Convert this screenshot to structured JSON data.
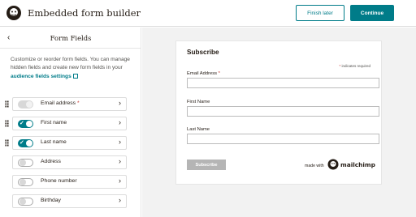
{
  "header": {
    "title": "Embedded form builder",
    "finish_later_label": "Finish later",
    "continue_label": "Continue"
  },
  "panel": {
    "back_glyph": "‹",
    "title": "Form Fields",
    "help_text": "Customize or reorder form fields. You can manage hidden fields and create new form fields in your ",
    "help_link": "audience fields settings",
    "fields": [
      {
        "label": "Email address",
        "required_mark": "*",
        "state": "disabled"
      },
      {
        "label": "First name",
        "state": "on"
      },
      {
        "label": "Last name",
        "state": "on"
      },
      {
        "label": "Address",
        "state": "off"
      },
      {
        "label": "Phone number",
        "state": "off"
      },
      {
        "label": "Birthday",
        "state": "off"
      }
    ],
    "chevron_glyph": "›",
    "check_glyph": "✓"
  },
  "preview": {
    "title": "Subscribe",
    "required_note_star": "*",
    "required_note": " indicates required",
    "email_label": "Email Address ",
    "email_star": "*",
    "first_name_label": "First Name",
    "last_name_label": "Last Name",
    "submit_label": "Subscribe",
    "made_with": "made with",
    "brand": "mailchimp"
  },
  "colors": {
    "accent": "#007c89",
    "required": "#c6322c",
    "preview_bg": "#f2f2f2"
  },
  "icons": {
    "logo": "mailchimp-freddie-icon",
    "back": "chevron-left-icon",
    "row_chevron": "chevron-right-icon",
    "drag": "drag-handle-icon",
    "external": "external-link-icon"
  }
}
